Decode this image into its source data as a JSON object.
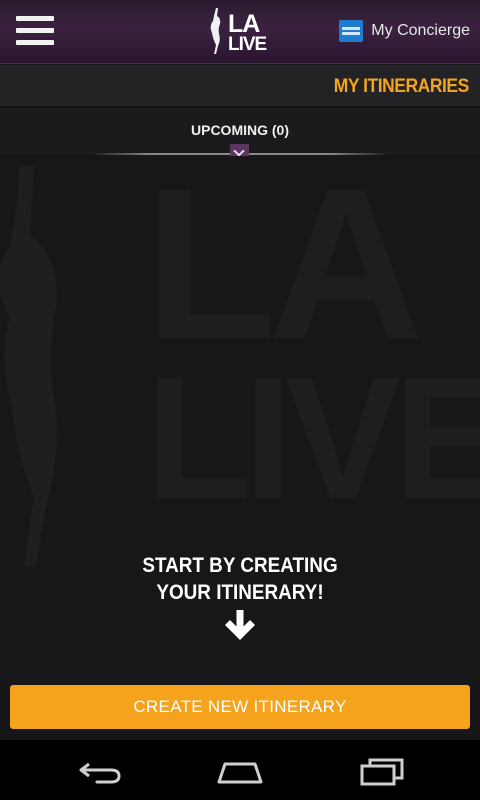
{
  "header": {
    "logo_line1": "LA",
    "logo_line2": "LIVE",
    "concierge_label": "My Concierge"
  },
  "page": {
    "title": "MY ITINERARIES"
  },
  "tabs": {
    "upcoming_label": "UPCOMING (0)"
  },
  "empty_state": {
    "line1": "START BY CREATING",
    "line2": "YOUR ITINERARY!"
  },
  "actions": {
    "create_label": "CREATE NEW ITINERARY"
  },
  "colors": {
    "accent": "#f4a41e",
    "header_purple": "#3b2240",
    "amex_blue": "#1e7ccf"
  }
}
